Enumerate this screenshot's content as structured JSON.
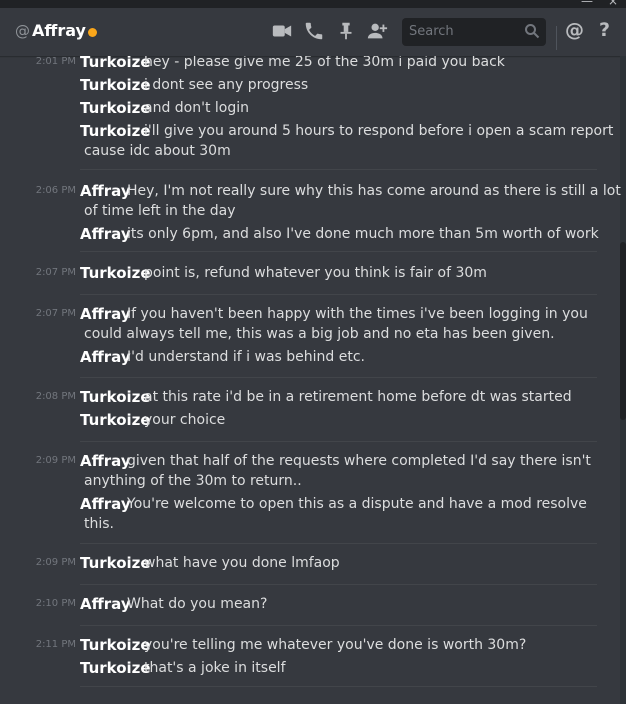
{
  "window": {
    "top_icons": [
      "—",
      "×"
    ]
  },
  "header": {
    "at": "@",
    "title": "Affray",
    "status_color": "#faa61a",
    "search_placeholder": "Search",
    "icons": [
      "video-icon",
      "phone-icon",
      "pin-icon",
      "add-member-icon",
      "search-icon",
      "mention-icon",
      "help-icon"
    ],
    "help_label": "?",
    "mention_label": "@"
  },
  "messages": [
    {
      "time": "2:01 PM",
      "lines": [
        {
          "author": "Turkoize",
          "text": "hey - please give me 25 of the 30m i paid you back"
        },
        {
          "author": "Turkoize",
          "text": "i dont see any progress"
        },
        {
          "author": "Turkoize",
          "text": "and don't login"
        },
        {
          "author": "Turkoize",
          "text": "i'll give you around 5 hours to respond before i open a scam report",
          "cont": "cause idc about 30m"
        }
      ]
    },
    {
      "time": "2:06 PM",
      "lines": [
        {
          "author": "Affray",
          "text": "Hey, I'm not really sure why this has come around as there is still a lot",
          "cont": "of time left in the day"
        },
        {
          "author": "Affray",
          "text": "its only 6pm, and also I've done much more than 5m worth of work"
        }
      ]
    },
    {
      "time": "2:07 PM",
      "lines": [
        {
          "author": "Turkoize",
          "text": "point is, refund whatever you think is fair of 30m"
        }
      ]
    },
    {
      "time": "2:07 PM",
      "lines": [
        {
          "author": "Affray",
          "text": "If you haven't been happy with the times i've been logging in you",
          "cont": "could always tell me, this was a big job and no eta has been given."
        },
        {
          "author": "Affray",
          "text": "I'd understand if i was behind etc."
        }
      ]
    },
    {
      "time": "2:08 PM",
      "lines": [
        {
          "author": "Turkoize",
          "text": "at this rate i'd be in a retirement home before dt was started"
        },
        {
          "author": "Turkoize",
          "text": "your choice"
        }
      ]
    },
    {
      "time": "2:09 PM",
      "lines": [
        {
          "author": "Affray",
          "text": "given that half of the requests where completed I'd say there isn't",
          "cont": "anything of the 30m to return.."
        },
        {
          "author": "Affray",
          "text": "You're welcome to open this as a dispute and have a mod resolve",
          "cont": "this."
        }
      ]
    },
    {
      "time": "2:09 PM",
      "lines": [
        {
          "author": "Turkoize",
          "text": "what have you done lmfaop"
        }
      ]
    },
    {
      "time": "2:10 PM",
      "lines": [
        {
          "author": "Affray",
          "text": "What do you mean?"
        }
      ]
    },
    {
      "time": "2:11 PM",
      "lines": [
        {
          "author": "Turkoize",
          "text": "you're telling me whatever you've done is worth 30m?"
        },
        {
          "author": "Turkoize",
          "text": "that's a joke in itself"
        }
      ]
    }
  ]
}
